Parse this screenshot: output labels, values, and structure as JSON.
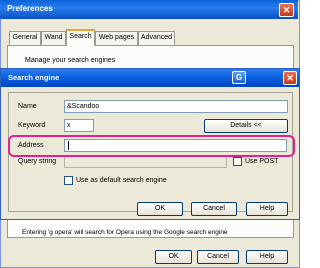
{
  "preferences": {
    "title": "Preferences",
    "close_glyph": "✕",
    "tabs": [
      {
        "label": "General"
      },
      {
        "label": "Wand"
      },
      {
        "label": "Search"
      },
      {
        "label": "Web pages"
      },
      {
        "label": "Advanced"
      }
    ],
    "active_tab": "Search",
    "description": "Manage your search engines",
    "footer_note": "Entering 'g opera' will search for Opera using the Google search engine",
    "ok_label": "OK",
    "cancel_label": "Cancel",
    "help_label": "Help"
  },
  "dialog": {
    "title": "Search engine",
    "help_glyph": "G",
    "close_glyph": "✕",
    "name_label": "Name",
    "name_value": "&Scandoo",
    "keyword_label": "Keyword",
    "keyword_value": "x",
    "details_label": "Details <<",
    "address_label": "Address",
    "address_value": "",
    "query_label": "Query string",
    "query_value": "",
    "use_post_label": "Use POST",
    "use_post_checked": false,
    "default_label": "Use as default search engine",
    "default_checked": false,
    "ok_label": "OK",
    "cancel_label": "Cancel",
    "help_label": "Help"
  },
  "colors": {
    "highlight": "#e2208e",
    "titlebar": "#0a5ee0"
  }
}
